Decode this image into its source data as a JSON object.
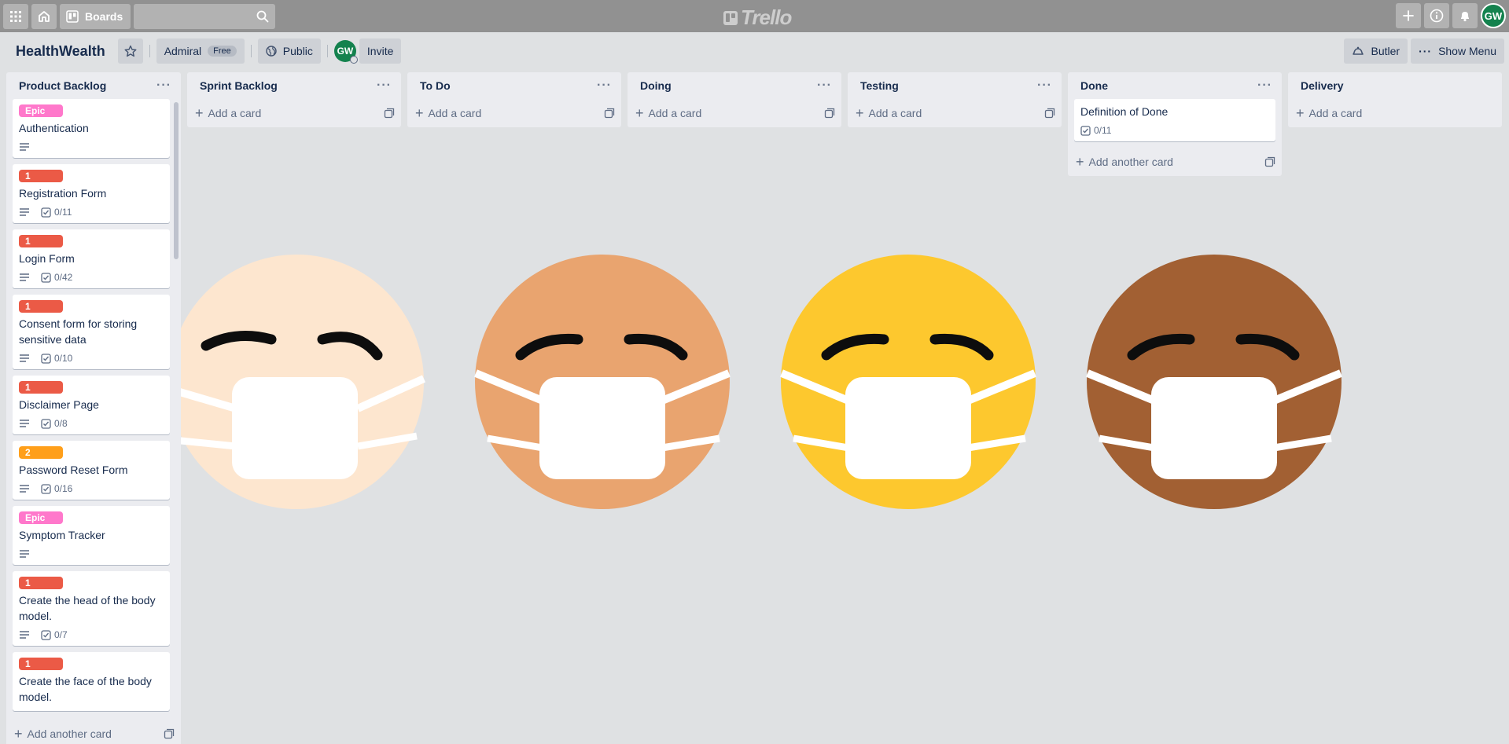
{
  "header": {
    "boards_label": "Boards",
    "logo_text": "Trello",
    "user_initials": "GW"
  },
  "board": {
    "title": "HealthWealth",
    "workspace": "Admiral",
    "plan": "Free",
    "visibility": "Public",
    "member_initials": "GW",
    "invite_label": "Invite",
    "butler_label": "Butler",
    "menu_label": "Show Menu"
  },
  "colors": {
    "label_red": "#eb5a46",
    "label_orange": "#ff9f1a",
    "label_pink": "#ff78cb",
    "topbar": "#919191",
    "avatar": "#14824e"
  },
  "lists": [
    {
      "title": "Product Backlog",
      "add_label": "Add another card",
      "cards": [
        {
          "label": "Epic",
          "label_color": "#ff78cb",
          "title": "Authentication",
          "desc": true,
          "checklist": ""
        },
        {
          "label": "1",
          "label_color": "#eb5a46",
          "title": "Registration Form",
          "desc": true,
          "checklist": "0/11"
        },
        {
          "label": "1",
          "label_color": "#eb5a46",
          "title": "Login Form",
          "desc": true,
          "checklist": "0/42"
        },
        {
          "label": "1",
          "label_color": "#eb5a46",
          "title": "Consent form for storing sensitive data",
          "desc": true,
          "checklist": "0/10"
        },
        {
          "label": "1",
          "label_color": "#eb5a46",
          "title": "Disclaimer Page",
          "desc": true,
          "checklist": "0/8"
        },
        {
          "label": "2",
          "label_color": "#ff9f1a",
          "title": "Password Reset Form",
          "desc": true,
          "checklist": "0/16"
        },
        {
          "label": "Epic",
          "label_color": "#ff78cb",
          "title": "Symptom Tracker",
          "desc": true,
          "checklist": ""
        },
        {
          "label": "1",
          "label_color": "#eb5a46",
          "title": "Create the head of the body model.",
          "desc": true,
          "checklist": "0/7"
        },
        {
          "label": "1",
          "label_color": "#eb5a46",
          "title": "Create the face of the body model.",
          "desc": false,
          "checklist": ""
        }
      ]
    },
    {
      "title": "Sprint Backlog",
      "add_label": "Add a card",
      "cards": []
    },
    {
      "title": "To Do",
      "add_label": "Add a card",
      "cards": []
    },
    {
      "title": "Doing",
      "add_label": "Add a card",
      "cards": []
    },
    {
      "title": "Testing",
      "add_label": "Add a card",
      "cards": []
    },
    {
      "title": "Done",
      "add_label": "Add another card",
      "cards": [
        {
          "label": "",
          "label_color": "",
          "title": "Definition of Done",
          "desc": false,
          "checklist": "0/11"
        }
      ]
    },
    {
      "title": "Delivery",
      "add_label": "Add a card",
      "cards": []
    }
  ],
  "background": {
    "emoji_colors": [
      "#fde6cf",
      "#e9a46f",
      "#fdc82e",
      "#a26033"
    ]
  }
}
